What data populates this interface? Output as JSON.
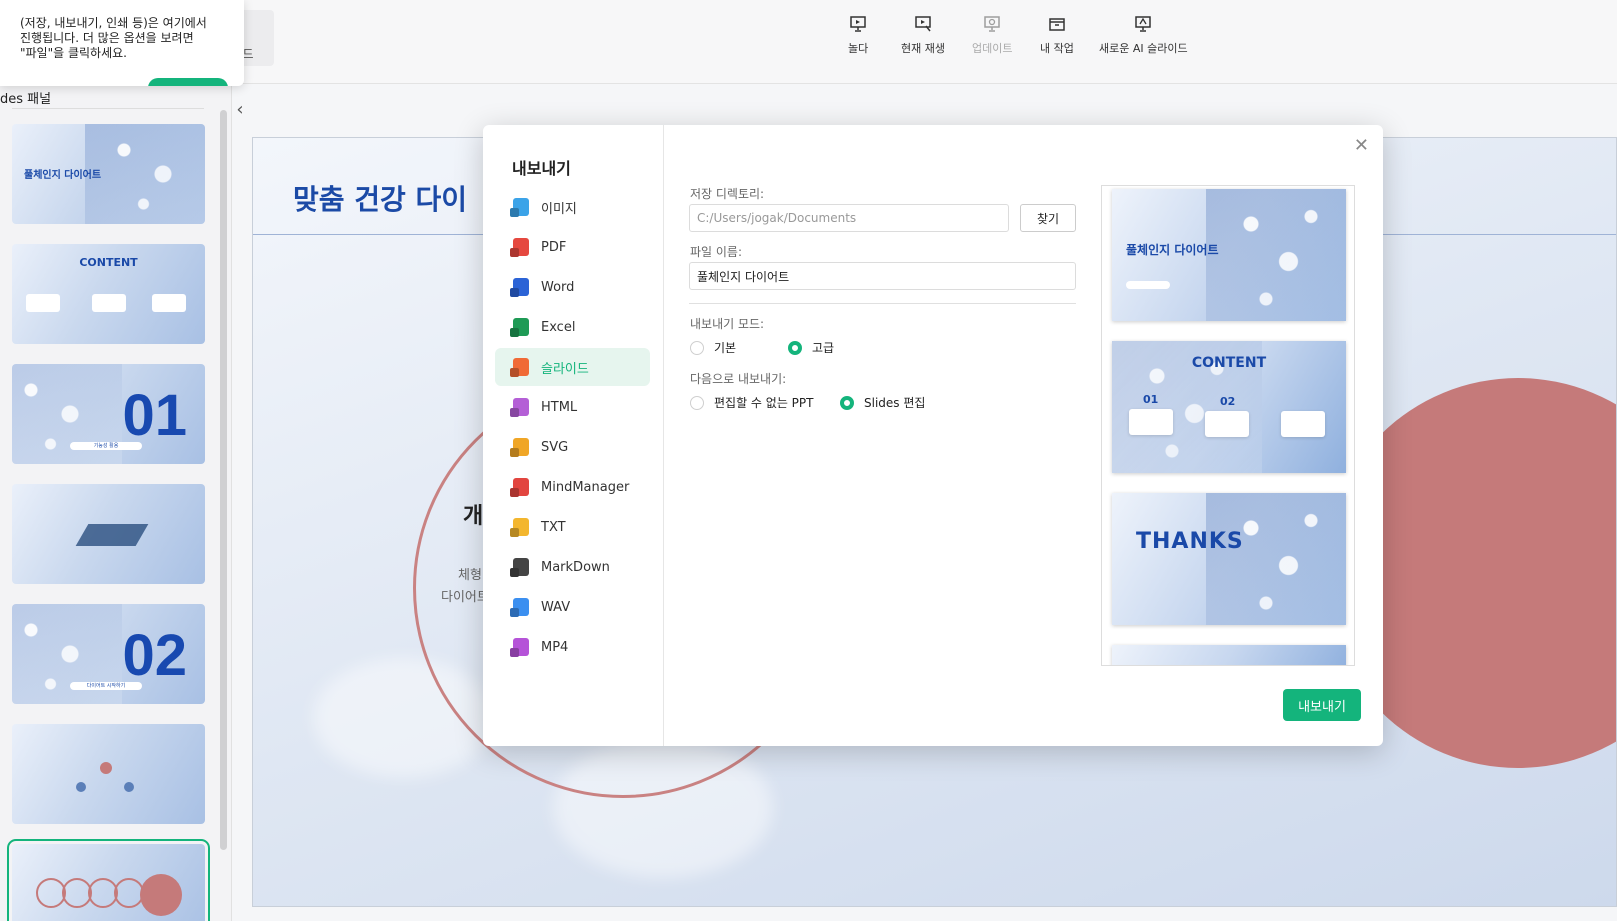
{
  "tooltip": {
    "line1": "(저장, 내보내기, 인쇄 등)은 여기에서",
    "line2": "진행됩니다. 더 많은 옵션을 보려면",
    "line3": "\"파일\"을 클릭하세요."
  },
  "toolbar": {
    "left_label": "드",
    "items": [
      {
        "label": "놀다",
        "icon": "play-slide-icon",
        "enabled": true
      },
      {
        "label": "현재 재생",
        "icon": "play-current-icon",
        "enabled": true
      },
      {
        "label": "업데이트",
        "icon": "update-icon",
        "enabled": false
      },
      {
        "label": "내 작업",
        "icon": "my-work-icon",
        "enabled": true
      },
      {
        "label": "새로운 AI 슬라이드",
        "icon": "new-ai-slide-icon",
        "enabled": true
      }
    ]
  },
  "left_panel": {
    "title": "des 패널",
    "thumbs": [
      {
        "title": "풀체인지 다이어트"
      },
      {
        "title": "CONTENT"
      },
      {
        "big": "01",
        "pill": "기능성 활용"
      },
      {
        "title": ""
      },
      {
        "big": "02",
        "pill": "다이어트 시작하기"
      },
      {
        "title": ""
      },
      {
        "title": ""
      }
    ]
  },
  "slide": {
    "title": "맞춤 건강 다이",
    "sub": "개",
    "t1": "체형",
    "t2": "다이어트"
  },
  "dialog": {
    "heading": "내보내기",
    "formats": [
      {
        "label": "이미지",
        "color": "#3ba3e8"
      },
      {
        "label": "PDF",
        "color": "#e5483f"
      },
      {
        "label": "Word",
        "color": "#2b63d6"
      },
      {
        "label": "Excel",
        "color": "#1e9a55"
      },
      {
        "label": "슬라이드",
        "color": "#f06a36"
      },
      {
        "label": "HTML",
        "color": "#b45fd6"
      },
      {
        "label": "SVG",
        "color": "#f0a626"
      },
      {
        "label": "MindManager",
        "color": "#e2453f"
      },
      {
        "label": "TXT",
        "color": "#f3b62e"
      },
      {
        "label": "MarkDown",
        "color": "#444444"
      },
      {
        "label": "WAV",
        "color": "#3b8ff0"
      },
      {
        "label": "MP4",
        "color": "#b553d8"
      }
    ],
    "active_format": "슬라이드",
    "dir_label": "저장 디렉토리:",
    "dir_value": "C:/Users/jogak/Documents",
    "find_label": "찾기",
    "filename_label": "파일 이름:",
    "filename_value": "풀체인지 다이어트",
    "mode_label": "내보내기 모드:",
    "mode_basic": "기본",
    "mode_advanced": "고급",
    "target_label": "다음으로 내보내기:",
    "target_ppt": "편집할 수 없는 PPT",
    "target_slides": "Slides 편집",
    "preview": {
      "p1_title": "풀체인지 다이어트",
      "p2_title": "CONTENT",
      "p2_n1": "01",
      "p2_n2": "02",
      "p3_title": "THANKS"
    },
    "export_label": "내보내기"
  }
}
